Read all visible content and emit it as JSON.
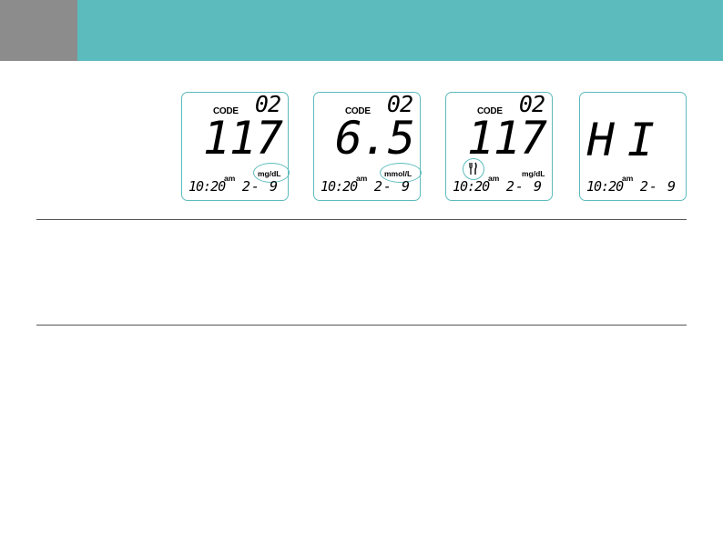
{
  "colors": {
    "accent": "#5cbbbc",
    "tab": "#8c8c8c"
  },
  "meters": [
    {
      "code_label": "CODE",
      "code": "02",
      "reading": "117",
      "unit": "mg/dL",
      "unit_circled": true,
      "time": "10:20",
      "ampm": "am",
      "date": "2-  9"
    },
    {
      "code_label": "CODE",
      "code": "02",
      "reading": "6.5",
      "unit": "mmol/L",
      "unit_circled": true,
      "time": "10:20",
      "ampm": "am",
      "date": "2-  9"
    },
    {
      "code_label": "CODE",
      "code": "02",
      "reading": "117",
      "unit": "mg/dL",
      "unit_circled": false,
      "meal_icon": "fork-knife-icon",
      "time": "10:20",
      "ampm": "am",
      "date": "2-  9"
    },
    {
      "code_label": "",
      "code": "",
      "reading": "HI",
      "unit": "",
      "time": "10:20",
      "ampm": "am",
      "date": "2-  9"
    }
  ]
}
